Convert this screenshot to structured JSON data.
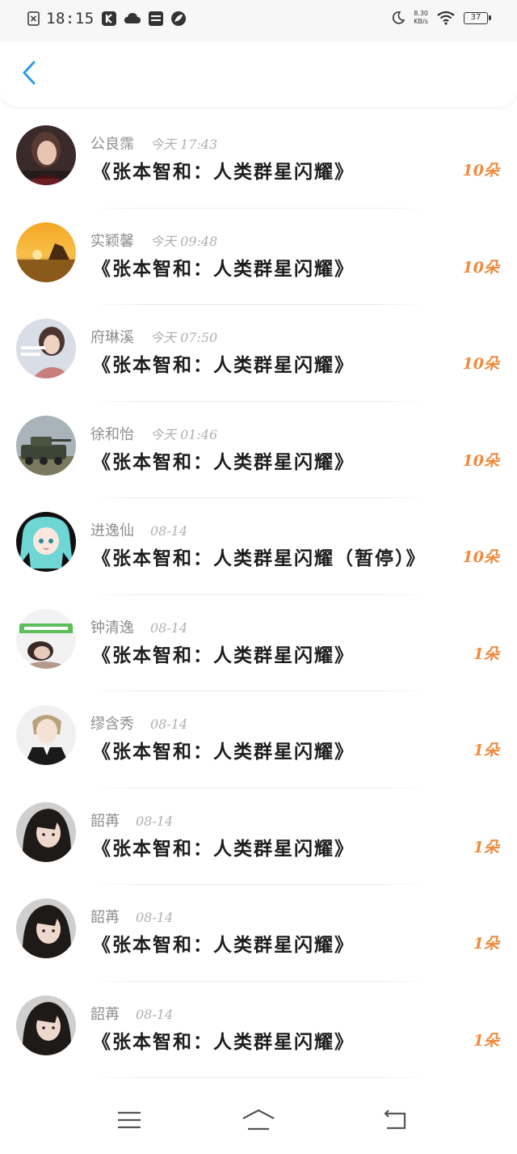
{
  "status_bar": {
    "time": "18:15",
    "net_speed_value": "8.30",
    "net_speed_unit": "KB/s",
    "battery": "37",
    "icons": [
      "close-box-icon",
      "k-app-icon",
      "cloud-icon",
      "card-icon",
      "leaf-icon",
      "moon-icon",
      "wifi-icon",
      "battery-icon"
    ]
  },
  "header": {
    "back_icon": "chevron-left-icon"
  },
  "colors": {
    "accent": "#2a9fe8",
    "count": "#f08a3e",
    "name": "#8e8e8e",
    "time": "#b0b0b0"
  },
  "items": [
    {
      "name": "公良霈",
      "time": "今天 17:43",
      "title": "《张本智和：人类群星闪耀》",
      "count": "10朵",
      "avatar": "avatar-girl-dark"
    },
    {
      "name": "实颖馨",
      "time": "今天 09:48",
      "title": "《张本智和：人类群星闪耀》",
      "count": "10朵",
      "avatar": "avatar-sunset"
    },
    {
      "name": "府琳溪",
      "time": "今天 07:50",
      "title": "《张本智和：人类群星闪耀》",
      "count": "10朵",
      "avatar": "avatar-girl-light"
    },
    {
      "name": "徐和怡",
      "time": "今天 01:46",
      "title": "《张本智和：人类群星闪耀》",
      "count": "10朵",
      "avatar": "avatar-tank"
    },
    {
      "name": "进逸仙",
      "time": "08-14",
      "title": "《张本智和：人类群星闪耀（暂停）》",
      "count": "10朵",
      "avatar": "avatar-anime-miku"
    },
    {
      "name": "钟清逸",
      "time": "08-14",
      "title": "《张本智和：人类群星闪耀》",
      "count": "1朵",
      "avatar": "avatar-girl-caption"
    },
    {
      "name": "缪含秀",
      "time": "08-14",
      "title": "《张本智和：人类群星闪耀》",
      "count": "1朵",
      "avatar": "avatar-anime-boy"
    },
    {
      "name": "韶苒",
      "time": "08-14",
      "title": "《张本智和：人类群星闪耀》",
      "count": "1朵",
      "avatar": "avatar-girl-hair"
    },
    {
      "name": "韶苒",
      "time": "08-14",
      "title": "《张本智和：人类群星闪耀》",
      "count": "1朵",
      "avatar": "avatar-girl-hair"
    },
    {
      "name": "韶苒",
      "time": "08-14",
      "title": "《张本智和：人类群星闪耀》",
      "count": "1朵",
      "avatar": "avatar-girl-hair"
    }
  ],
  "nav": {
    "icons": [
      "menu-icon",
      "home-icon",
      "back-icon"
    ]
  }
}
